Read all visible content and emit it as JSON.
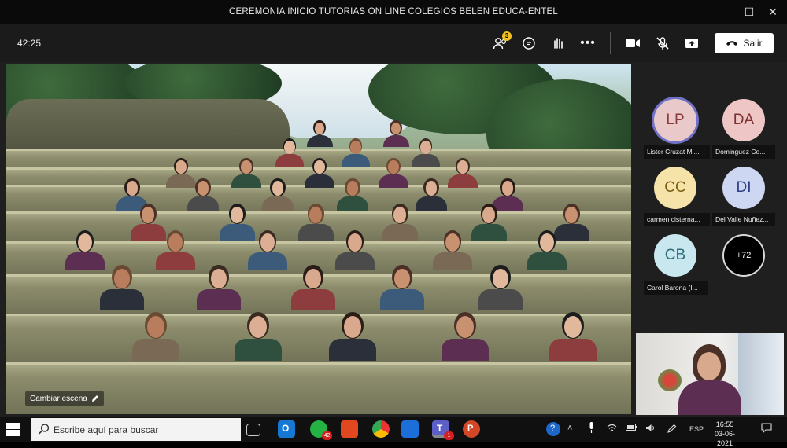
{
  "window": {
    "title": "CEREMONIA INICIO TUTORIAS ON LINE COLEGIOS BELEN EDUCA-ENTEL"
  },
  "toolbar": {
    "timer": "42:25",
    "participants_badge": "3",
    "leave_label": "Salir"
  },
  "stage": {
    "change_scene_label": "Cambiar escena"
  },
  "participants": [
    {
      "initials": "LP",
      "name": "Lister Cruzat Mi...",
      "bg": "#e9c9c9",
      "fg": "#8a3a3a",
      "active": true
    },
    {
      "initials": "DA",
      "name": "Dominguez Co...",
      "bg": "#efc6c6",
      "fg": "#7d2f2f",
      "active": false
    },
    {
      "initials": "CC",
      "name": "carmen cisterna...",
      "bg": "#f6e3a9",
      "fg": "#7a5e10",
      "active": false
    },
    {
      "initials": "DI",
      "name": "Del Valle Nuñez...",
      "bg": "#cdd7f2",
      "fg": "#2e3f86",
      "active": false
    },
    {
      "initials": "CB",
      "name": "Carol Barona (I...",
      "bg": "#c8e7ee",
      "fg": "#2f6d7a",
      "active": false
    }
  ],
  "overflow_count": "+72",
  "taskbar": {
    "search_placeholder": "Escribe aquí para buscar",
    "whatsapp_badge": "42",
    "teams_badge": "1",
    "language": "ESP",
    "time": "16:55",
    "date": "03-06-2021"
  }
}
